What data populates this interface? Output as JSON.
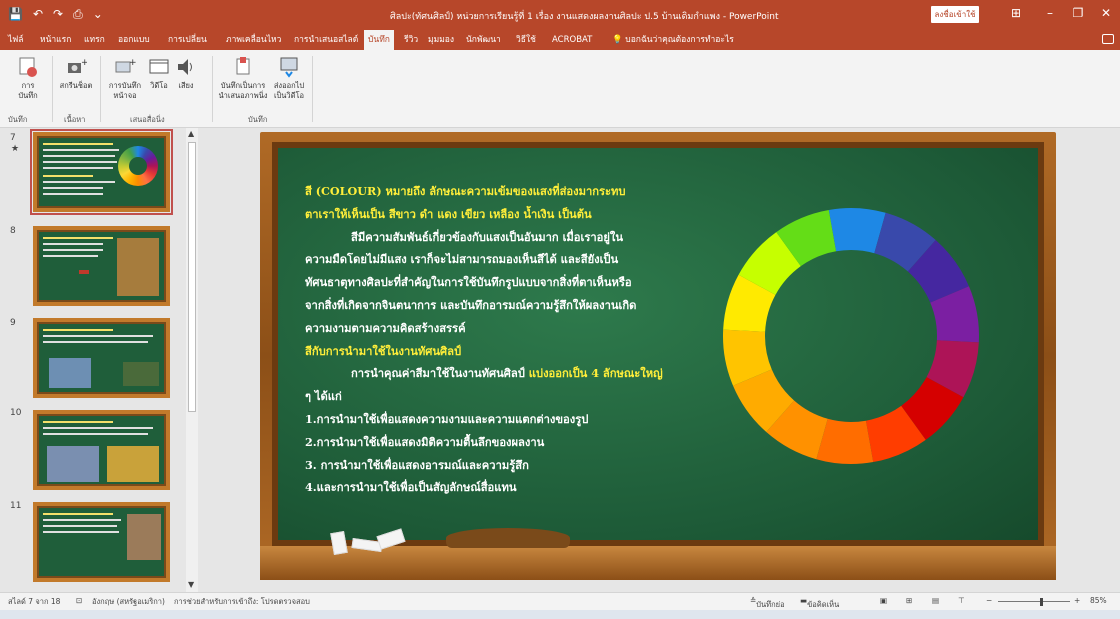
{
  "app": {
    "title": "ศิลปะ(ทัศนศิลป์) หน่วยการเรียนรู้ที่ 1 เรื่อง งานแสดงผลงานศิลปะ ป.5 บ้านเดิมกำแพง - PowerPoint",
    "signin": "ลงชื่อเข้าใช้",
    "qat": [
      "💾",
      "↶",
      "↷",
      "⎙",
      "⌄"
    ]
  },
  "tabs": [
    "ไฟล์",
    "หน้าแรก",
    "แทรก",
    "ออกแบบ",
    "การเปลี่ยน",
    "ภาพเคลื่อนไหว",
    "การนำเสนอสไลด์",
    "บันทึก",
    "รีวิว",
    "มุมมอง",
    "นักพัฒนา",
    "วิธีใช้",
    "ACROBAT"
  ],
  "active_tab": "บันทึก",
  "tell_me": "บอกฉันว่าคุณต้องการทำอะไร",
  "ribbon": {
    "buttons": [
      {
        "label": "การ\nบันทึก",
        "icon": "record-icon"
      },
      {
        "label": "สกรีนช็อต",
        "icon": "screenshot-icon"
      },
      {
        "label": "การบันทึก\nหน้าจอ",
        "icon": "screen-recording-icon"
      },
      {
        "label": "วิดีโอ",
        "icon": "video-icon"
      },
      {
        "label": "เสียง",
        "icon": "audio-icon"
      },
      {
        "label": "บันทึกเป็นการ\nนำเสนอภาพนิ่ง",
        "icon": "save-show-icon"
      },
      {
        "label": "ส่งออกไป\nเป็นวิดีโอ",
        "icon": "export-video-icon"
      }
    ],
    "groups": [
      "บันทึก",
      "เนื้อหา",
      "เสนอสื่อนิ่ง",
      "บันทึก"
    ]
  },
  "thumbnails": [
    {
      "num": "7",
      "star": "★",
      "selected": true
    },
    {
      "num": "8",
      "star": "",
      "selected": false
    },
    {
      "num": "9",
      "star": "",
      "selected": false
    },
    {
      "num": "10",
      "star": "",
      "selected": false
    },
    {
      "num": "11",
      "star": "",
      "selected": false
    }
  ],
  "slide": {
    "lines": [
      "สี (COLOUR) หมายถึง ลักษณะความเข้มของแสงที่ส่องมากระทบ",
      "ตาเราให้เห็นเป็น สีขาว ดำ แดง เขียว เหลือง น้ำเงิน เป็นต้น",
      "สีมีความสัมพันธ์เกี่ยวข้องกับแสงเป็นอันมาก เมื่อเราอยู่ใน",
      "ความมืดโดยไม่มีแสง เราก็จะไม่สามารถมองเห็นสีได้ และสียังเป็น",
      "ทัศนธาตุทางศิลปะที่สำคัญในการใช้บันทึกรูปแบบจากสิ่งที่ตาเห็นหรือ",
      "จากสิ่งที่เกิดจากจินตนาการ และบันทึกอารมณ์ความรู้สึกให้ผลงานเกิด",
      "ความงามตามความคิดสร้างสรรค์",
      "สีกับการนำมาใช้ในงานทัศนศิลป์",
      "การนำคุณค่าสีมาใช้ในงานทัศนศิลป์",
      "แบ่งออกเป็น 4 ลักษณะใหญ่",
      "ๆ ได้แก่",
      "1.การนำมาใช้เพื่อแสดงความงามและความแตกต่างของรูป",
      "2.การนำมาใช้เพื่อแสดงมิติความตื้นลึกของผลงาน",
      "3. การนำมาใช้เพื่อแสดงอารมณ์และความรู้สึก",
      "4.และการนำมาใช้เพื่อเป็นสัญลักษณ์สื่อแทน"
    ],
    "wheel_colors": [
      "#1e88e5",
      "#3949ab",
      "#4527a0",
      "#7b1fa2",
      "#ad1457",
      "#d50000",
      "#ff3d00",
      "#ff6d00",
      "#ff9100",
      "#ffab00",
      "#ffc400",
      "#ffea00",
      "#c6ff00",
      "#64dd17"
    ]
  },
  "status": {
    "slide_info": "สไลด์ 7 จาก 18",
    "language": "อังกฤษ (สหรัฐอเมริกา)",
    "accessibility": "การช่วยสำหรับการเข้าถึง: โปรดตรวจสอบ",
    "notes": "บันทึกย่อ",
    "comments": "ข้อคิดเห็น",
    "zoom": "85%"
  }
}
